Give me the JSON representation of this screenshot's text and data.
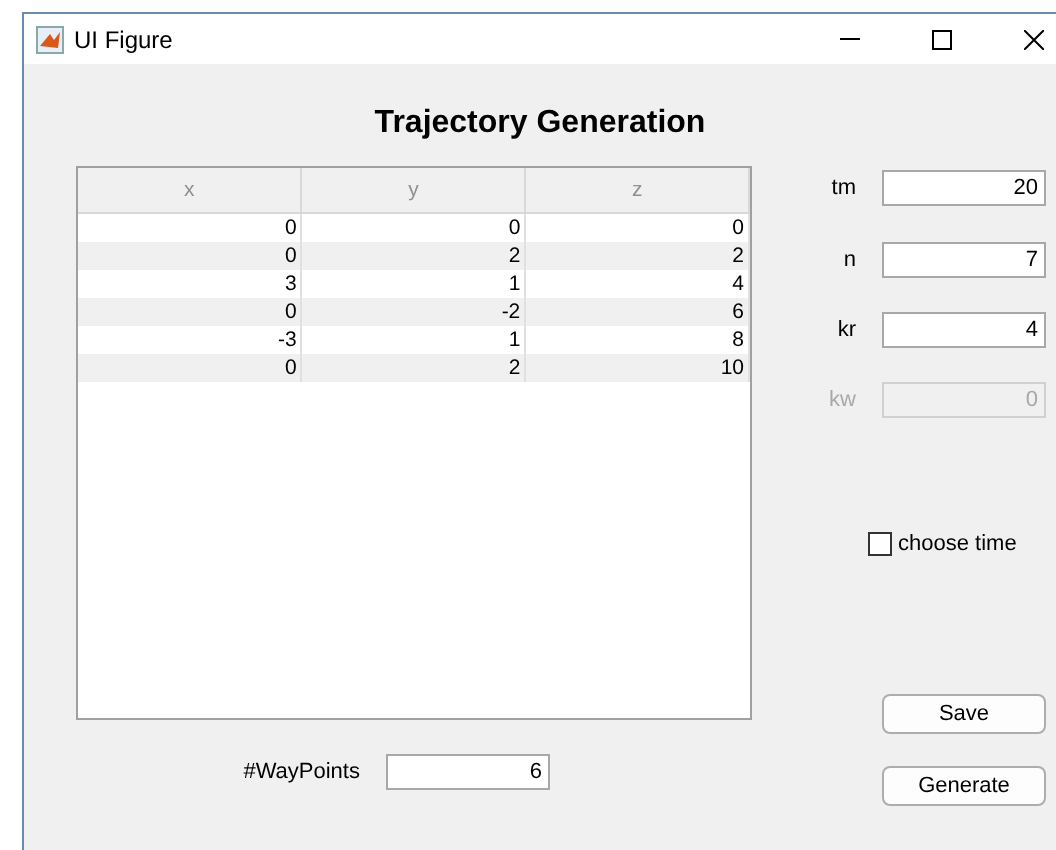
{
  "window": {
    "title": "UI Figure"
  },
  "heading": "Trajectory Generation",
  "table": {
    "columns": [
      "x",
      "y",
      "z"
    ],
    "rows": [
      [
        "0",
        "0",
        "0"
      ],
      [
        "0",
        "2",
        "2"
      ],
      [
        "3",
        "1",
        "4"
      ],
      [
        "0",
        "-2",
        "6"
      ],
      [
        "-3",
        "1",
        "8"
      ],
      [
        "0",
        "2",
        "10"
      ]
    ]
  },
  "fields": [
    {
      "label": "tm",
      "value": "20",
      "disabled": false
    },
    {
      "label": "n",
      "value": "7",
      "disabled": false
    },
    {
      "label": "kr",
      "value": "4",
      "disabled": false
    },
    {
      "label": "kw",
      "value": "0",
      "disabled": true
    }
  ],
  "choose_time": {
    "label": "choose time",
    "checked": false
  },
  "buttons": [
    "Save",
    "Generate"
  ],
  "waypoints": {
    "label": "#WayPoints",
    "value": "6"
  }
}
